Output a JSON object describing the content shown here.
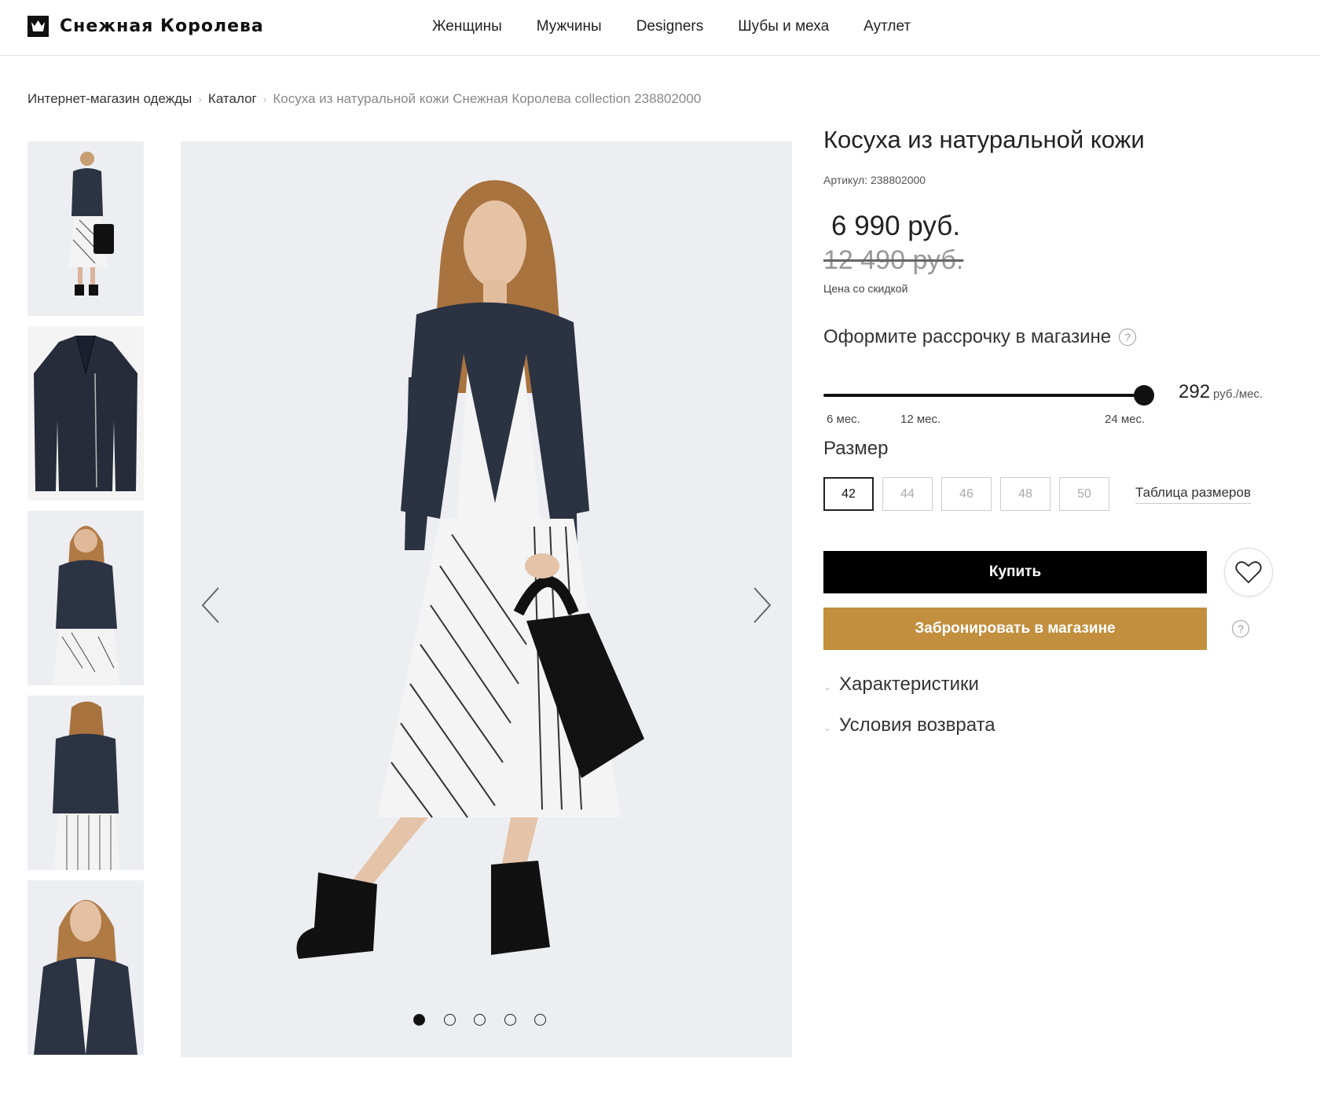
{
  "header": {
    "logo_text": "Снежная Королева",
    "nav": [
      "Женщины",
      "Мужчины",
      "Designers",
      "Шубы и меха",
      "Аутлет"
    ]
  },
  "breadcrumb": {
    "items": [
      "Интернет-магазин одежды",
      "Каталог"
    ],
    "current": "Косуха из натуральной кожи Снежная Королева collection 238802000"
  },
  "gallery": {
    "thumbnail_count": 5,
    "slide_count": 5,
    "active_slide": 1
  },
  "product": {
    "title": "Косуха из натуральной кожи",
    "article": "Артикул: 238802000",
    "price": "6 990 руб.",
    "old_price": "12 490 руб.",
    "discount_label": "Цена со скидкой"
  },
  "installment": {
    "label": "Оформите рассрочку в магазине",
    "help": "?",
    "amount": "292",
    "unit": "руб./мес.",
    "ticks": [
      "6 мес.",
      "12 мес.",
      "24 мес."
    ],
    "selected": "24 мес."
  },
  "size": {
    "label": "Размер",
    "options": [
      "42",
      "44",
      "46",
      "48",
      "50"
    ],
    "selected": "42",
    "table_link": "Таблица размеров"
  },
  "actions": {
    "buy": "Купить",
    "reserve": "Забронировать в магазине",
    "reserve_help": "?"
  },
  "accordion": [
    "Характеристики",
    "Условия возврата"
  ],
  "colors": {
    "accent_gold": "#c28f3e",
    "buy_button": "#000000",
    "image_background": "#eceef2"
  }
}
